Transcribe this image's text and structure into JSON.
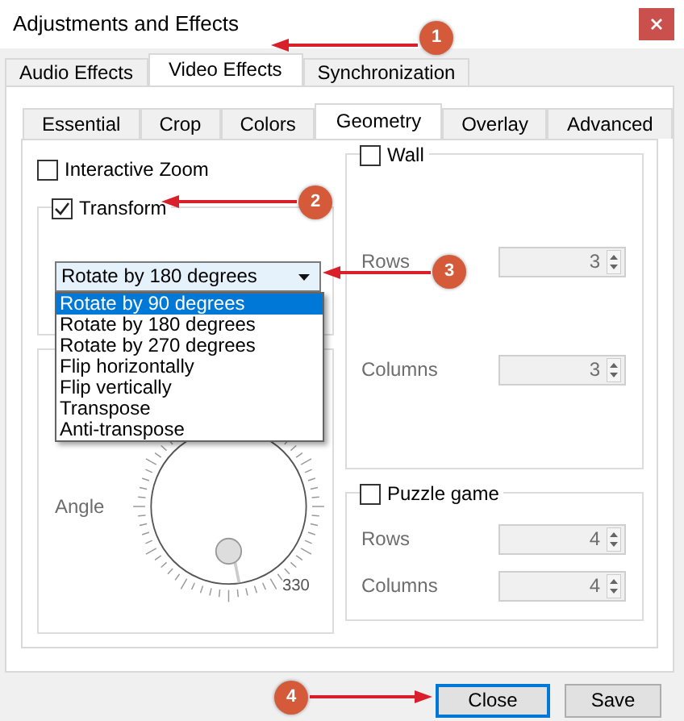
{
  "window": {
    "title": "Adjustments and Effects"
  },
  "tabs": [
    {
      "label": "Audio Effects",
      "selected": false
    },
    {
      "label": "Video Effects",
      "selected": true
    },
    {
      "label": "Synchronization",
      "selected": false
    }
  ],
  "subtabs": [
    {
      "label": "Essential",
      "selected": false
    },
    {
      "label": "Crop",
      "selected": false
    },
    {
      "label": "Colors",
      "selected": false
    },
    {
      "label": "Geometry",
      "selected": true
    },
    {
      "label": "Overlay",
      "selected": false
    },
    {
      "label": "Advanced",
      "selected": false
    }
  ],
  "interactive_zoom": {
    "label": "Interactive Zoom",
    "checked": false
  },
  "transform": {
    "label": "Transform",
    "checked": true,
    "value": "Rotate by 180 degrees",
    "expanded": true,
    "options": [
      {
        "label": "Rotate by 90 degrees",
        "highlighted": true
      },
      {
        "label": "Rotate by 180 degrees",
        "highlighted": false
      },
      {
        "label": "Rotate by 270 degrees",
        "highlighted": false
      },
      {
        "label": "Flip horizontally",
        "highlighted": false
      },
      {
        "label": "Flip vertically",
        "highlighted": false
      },
      {
        "label": "Transpose",
        "highlighted": false
      },
      {
        "label": "Anti-transpose",
        "highlighted": false
      }
    ]
  },
  "rotate": {
    "angle_label": "Angle",
    "tick_label": "330"
  },
  "wall": {
    "label": "Wall",
    "checked": false,
    "disabled": true,
    "fields": [
      {
        "label": "Rows",
        "value": "3"
      },
      {
        "label": "Columns",
        "value": "3"
      }
    ]
  },
  "puzzle": {
    "label": "Puzzle game",
    "checked": false,
    "disabled": true,
    "fields": [
      {
        "label": "Rows",
        "value": "4"
      },
      {
        "label": "Columns",
        "value": "4"
      }
    ]
  },
  "buttons": [
    {
      "label": "Close",
      "focused": true
    },
    {
      "label": "Save",
      "focused": false
    }
  ],
  "annotations": [
    {
      "number": "1"
    },
    {
      "number": "2"
    },
    {
      "number": "3"
    },
    {
      "number": "4"
    }
  ]
}
